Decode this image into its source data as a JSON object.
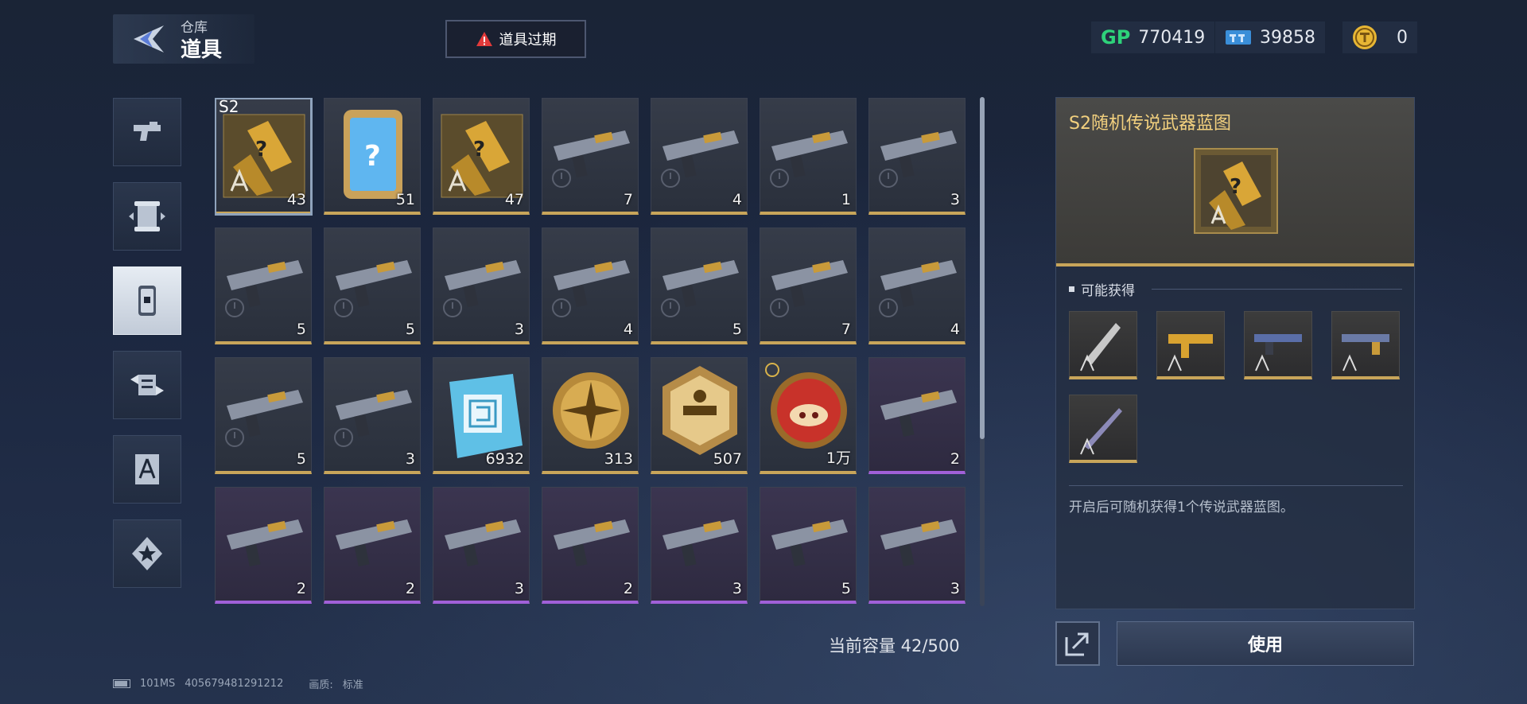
{
  "header": {
    "breadcrumb_small": "仓库",
    "title": "道具",
    "expire_button": "道具过期"
  },
  "currencies": [
    {
      "icon": "GP",
      "value": "770419"
    },
    {
      "icon": "ticket-icon",
      "value": "39858"
    },
    {
      "icon": "coin-icon",
      "value": "0"
    }
  ],
  "side_tabs": [
    {
      "name": "pistol-icon",
      "active": false
    },
    {
      "name": "scroll-icon",
      "active": false
    },
    {
      "name": "item-icon",
      "active": true
    },
    {
      "name": "swap-icon",
      "active": false
    },
    {
      "name": "blueprint-icon",
      "active": false
    },
    {
      "name": "star-icon",
      "active": false
    }
  ],
  "items": [
    {
      "count": "43",
      "tag": "S2",
      "kind": "blueprint",
      "rarity": "gold"
    },
    {
      "count": "51",
      "kind": "card",
      "rarity": "gold"
    },
    {
      "count": "47",
      "kind": "blueprint",
      "rarity": "gold"
    },
    {
      "count": "7",
      "kind": "gun",
      "rarity": "gold"
    },
    {
      "count": "4",
      "kind": "gun",
      "rarity": "gold"
    },
    {
      "count": "1",
      "kind": "gun",
      "rarity": "gold"
    },
    {
      "count": "3",
      "kind": "gun",
      "rarity": "gold"
    },
    {
      "count": "5",
      "kind": "gun",
      "rarity": "gold"
    },
    {
      "count": "5",
      "kind": "gun",
      "rarity": "gold"
    },
    {
      "count": "3",
      "kind": "gun",
      "rarity": "gold"
    },
    {
      "count": "4",
      "kind": "gun",
      "rarity": "gold"
    },
    {
      "count": "5",
      "kind": "gun",
      "rarity": "gold"
    },
    {
      "count": "7",
      "kind": "gun",
      "rarity": "gold"
    },
    {
      "count": "4",
      "kind": "gun",
      "rarity": "gold"
    },
    {
      "count": "5",
      "kind": "gun",
      "rarity": "gold"
    },
    {
      "count": "3",
      "kind": "gun",
      "rarity": "gold"
    },
    {
      "count": "6932",
      "kind": "chip",
      "rarity": "gold"
    },
    {
      "count": "313",
      "kind": "medal",
      "rarity": "gold"
    },
    {
      "count": "507",
      "kind": "badge",
      "rarity": "gold"
    },
    {
      "count": "1万",
      "kind": "pig",
      "rarity": "gold"
    },
    {
      "count": "2",
      "kind": "gun",
      "rarity": "purple"
    },
    {
      "count": "2",
      "kind": "gun",
      "rarity": "purple"
    },
    {
      "count": "2",
      "kind": "gun",
      "rarity": "purple"
    },
    {
      "count": "3",
      "kind": "gun",
      "rarity": "purple"
    },
    {
      "count": "2",
      "kind": "gun",
      "rarity": "purple"
    },
    {
      "count": "3",
      "kind": "gun",
      "rarity": "purple"
    },
    {
      "count": "5",
      "kind": "gun",
      "rarity": "purple"
    },
    {
      "count": "3",
      "kind": "gun",
      "rarity": "purple"
    }
  ],
  "capacity": "当前容量 42/500",
  "detail": {
    "title": "S2随机传说武器蓝图",
    "section": "可能获得",
    "description": "开启后可随机获得1个传说武器蓝图。",
    "rewards": [
      "blueprint",
      "blueprint",
      "blueprint",
      "blueprint",
      "blueprint"
    ]
  },
  "buttons": {
    "use": "使用"
  },
  "footer": {
    "ping": "101MS",
    "uid": "405679481291212",
    "quality_label": "画质:",
    "quality_value": "标准"
  }
}
